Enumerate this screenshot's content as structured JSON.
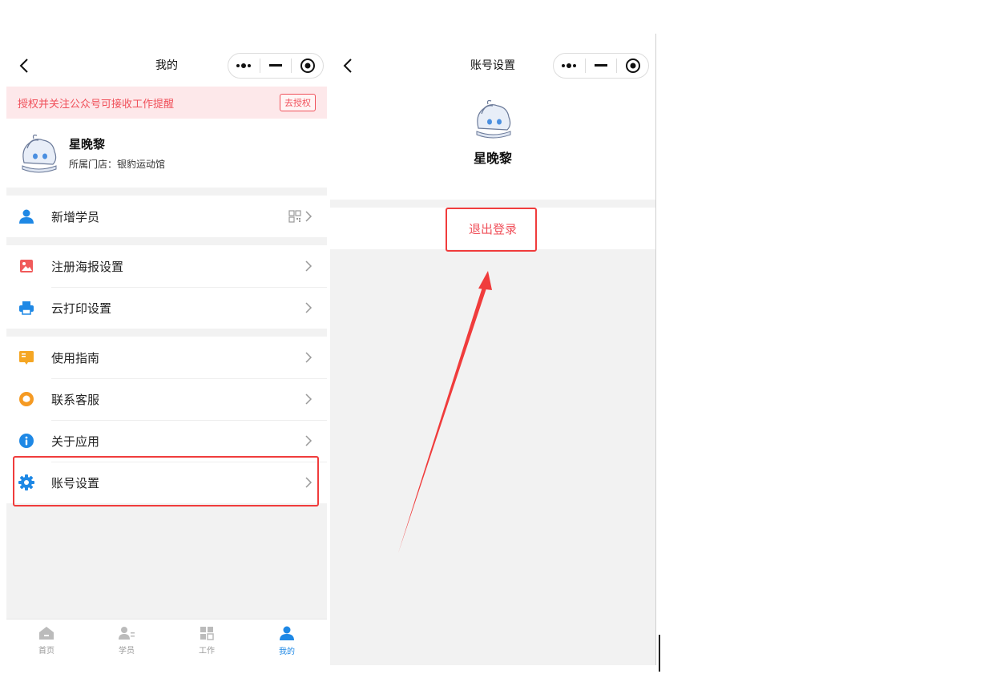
{
  "left": {
    "nav_title": "我的",
    "banner": {
      "text": "授权并关注公众号可接收工作提醒",
      "button": "去授权"
    },
    "profile": {
      "name": "星晚黎",
      "store": "所属门店：银豹运动馆"
    },
    "menu_groups": [
      [
        {
          "label": "新增学员",
          "icon": "add-user-icon",
          "right": "qr-code-icon"
        }
      ],
      [
        {
          "label": "注册海报设置",
          "icon": "poster-icon"
        },
        {
          "label": "云打印设置",
          "icon": "printer-icon"
        }
      ],
      [
        {
          "label": "使用指南",
          "icon": "guide-book-icon"
        },
        {
          "label": "联系客服",
          "icon": "customer-service-icon"
        },
        {
          "label": "关于应用",
          "icon": "info-icon"
        },
        {
          "label": "账号设置",
          "icon": "gear-icon"
        }
      ]
    ],
    "tabs": [
      {
        "label": "首页",
        "icon": "home-icon"
      },
      {
        "label": "学员",
        "icon": "students-icon"
      },
      {
        "label": "工作",
        "icon": "grid-icon"
      },
      {
        "label": "我的",
        "icon": "me-icon",
        "active": true
      }
    ]
  },
  "right": {
    "nav_title": "账号设置",
    "profile_name": "星晚黎",
    "logout": "退出登录"
  },
  "colors": {
    "accent_blue": "#1e88e5",
    "danger_red": "#f0505a",
    "annotation_red": "#f03c3c",
    "banner_bg": "#fde8ea"
  }
}
